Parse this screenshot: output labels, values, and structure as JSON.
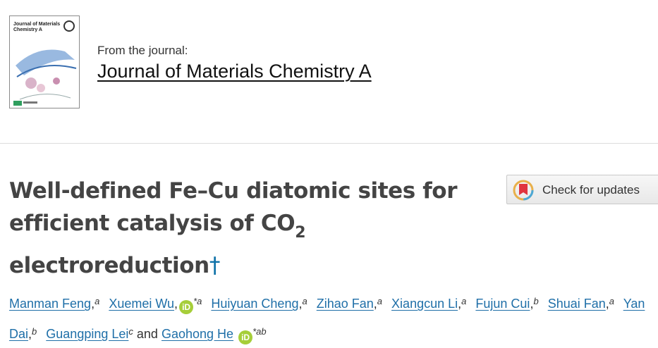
{
  "journal": {
    "from_label": "From the journal:",
    "name": "Journal of Materials Chemistry A",
    "cover_title": "Journal of Materials Chemistry A"
  },
  "article": {
    "title_line1": "Well-defined Fe–Cu diatomic sites for",
    "title_line2a": "efficient catalysis of CO",
    "title_sub": "2",
    "title_line3": "electroreduction",
    "dagger": "†"
  },
  "updates": {
    "label": "Check for updates"
  },
  "authors": {
    "a1": "Manman Feng",
    "a1_aff": "a",
    "a2": "Xuemei Wu",
    "a2_aff": "*a",
    "a3": "Huiyuan Cheng",
    "a3_aff": "a",
    "a4": "Zihao Fan",
    "a4_aff": "a",
    "a5": "Xiangcun Li",
    "a5_aff": "a",
    "a6": "Fujun Cui",
    "a6_aff": "b",
    "a7": "Shuai Fan",
    "a7_aff": "a",
    "a8": "Yan Dai",
    "a8_aff": "b",
    "a9": "Guangping Lei",
    "a9_aff": "c",
    "and": "and",
    "a10": "Gaohong He",
    "a10_aff": "*ab",
    "orcid_label": "iD"
  },
  "colors": {
    "link": "#1f6fa8",
    "orcid": "#a6ce39",
    "dagger": "#0f72a8"
  }
}
